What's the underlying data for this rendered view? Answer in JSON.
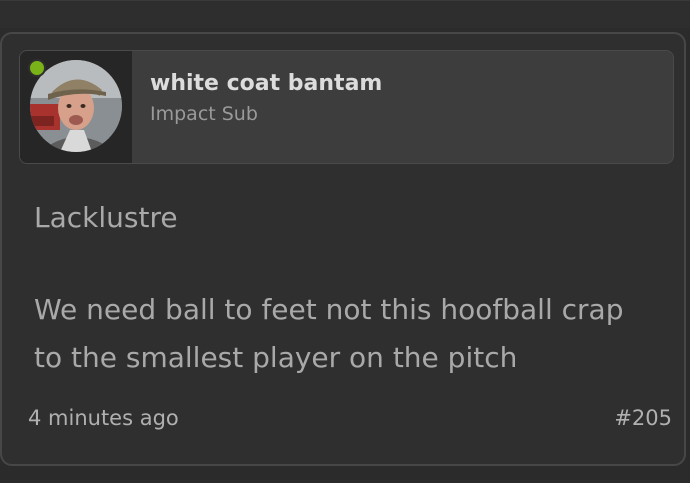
{
  "post": {
    "author": {
      "name": "white coat bantam",
      "role": "Impact Sub",
      "online": true
    },
    "body": {
      "paragraph_1": "Lacklustre",
      "paragraph_2": "We need ball to feet not this hoofball crap to the smallest player on the pitch"
    },
    "time_ago": "4 minutes ago",
    "number": "#205"
  },
  "colors": {
    "online_indicator": "#7ab317",
    "background": "#2b2b2b",
    "card": "#2f2f2f"
  }
}
